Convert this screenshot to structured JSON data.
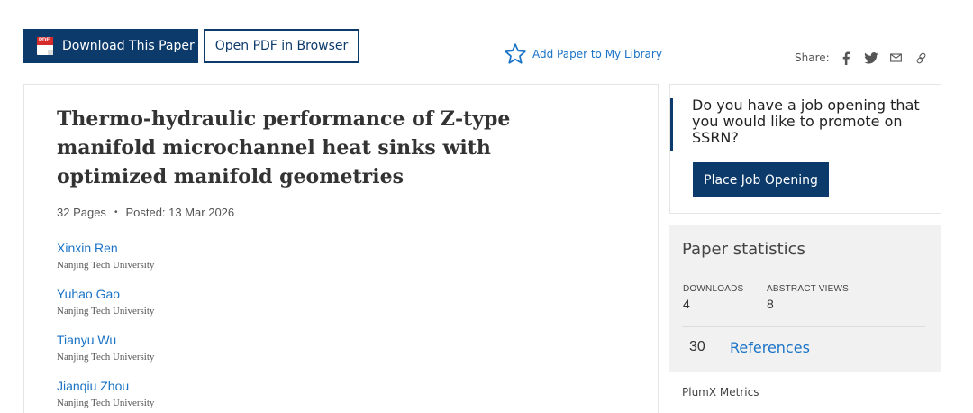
{
  "actions": {
    "download_label": "Download This Paper",
    "pdf_icon_text": "PDF",
    "open_pdf_label": "Open PDF in Browser",
    "add_library_label": "Add Paper to My Library",
    "share_label": "Share:",
    "share_icons": [
      "facebook-icon",
      "twitter-icon",
      "email-icon",
      "link-icon"
    ]
  },
  "paper": {
    "title": "Thermo-hydraulic performance of Z-type manifold microchannel heat sinks with optimized manifold geometries",
    "pages": "32 Pages",
    "dot": "•",
    "posted": "Posted: 13 Mar 2026",
    "authors": [
      {
        "name": "Xinxin Ren",
        "affiliation": "Nanjing Tech University"
      },
      {
        "name": "Yuhao Gao",
        "affiliation": "Nanjing Tech University"
      },
      {
        "name": "Tianyu Wu",
        "affiliation": "Nanjing Tech University"
      },
      {
        "name": "Jianqiu Zhou",
        "affiliation": "Nanjing Tech University"
      }
    ]
  },
  "job": {
    "prompt": "Do you have a job opening that you would like to promote on SSRN?",
    "button_label": "Place Job Opening"
  },
  "stats": {
    "title": "Paper statistics",
    "downloads_label": "DOWNLOADS",
    "downloads_value": "4",
    "abstract_views_label": "ABSTRACT VIEWS",
    "abstract_views_value": "8",
    "references_count": "30",
    "references_label": "References"
  },
  "plumx_label": "PlumX Metrics",
  "colors": {
    "primary": "#0c3b6b",
    "link": "#1a73c6",
    "pdf_red": "#d62b2b",
    "stats_bg": "#f1f1f1"
  }
}
